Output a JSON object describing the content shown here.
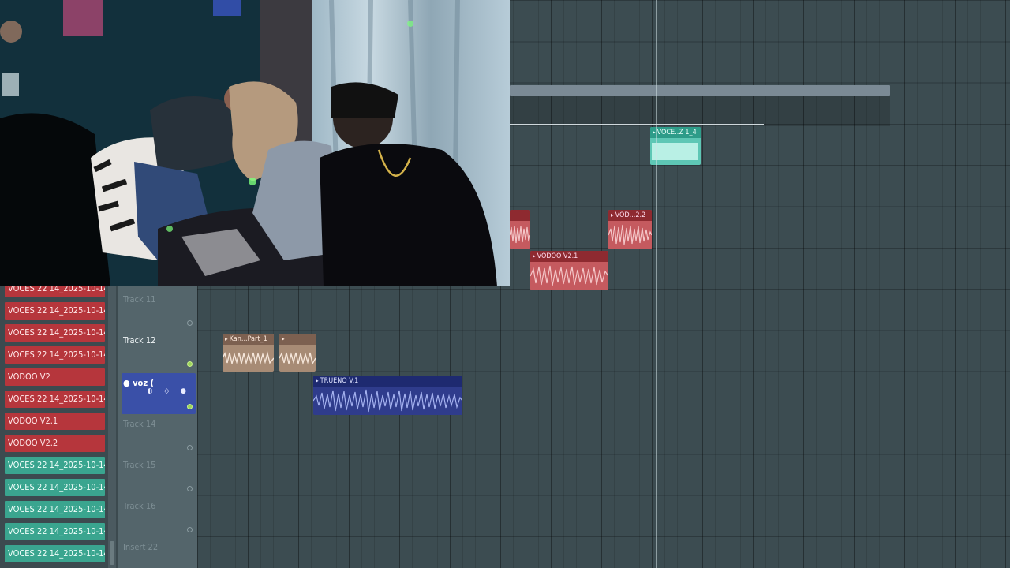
{
  "app": "FL Studio Playlist",
  "tracks": [
    {
      "name": "Track 11",
      "state": "faded"
    },
    {
      "name": "Track 12",
      "state": "normal"
    },
    {
      "name": "voz (",
      "state": "selected"
    },
    {
      "name": "Track 14",
      "state": "faded"
    },
    {
      "name": "Track 15",
      "state": "faded"
    },
    {
      "name": "Track 16",
      "state": "faded"
    },
    {
      "name": "Insert 22",
      "state": "faded"
    }
  ],
  "samples": [
    {
      "label": "VOCES 22 14_2025-10-14...",
      "color": "red"
    },
    {
      "label": "VOCES 22 14_2025-10-14...",
      "color": "red"
    },
    {
      "label": "VOCES 22 14_2025-10-14...",
      "color": "red"
    },
    {
      "label": "VOCES 22 14_2025-10-14...",
      "color": "red"
    },
    {
      "label": "VODOO V2",
      "color": "red"
    },
    {
      "label": "VOCES 22 14_2025-10-14...",
      "color": "red"
    },
    {
      "label": "VODOO V2.1",
      "color": "red"
    },
    {
      "label": "VODOO V2.2",
      "color": "red"
    },
    {
      "label": "VOCES 22 14_2025-10-14...",
      "color": "teal"
    },
    {
      "label": "VOCES 22 14_2025-10-14...",
      "color": "teal"
    },
    {
      "label": "VOCES 22 14_2025-10-14...",
      "color": "teal"
    },
    {
      "label": "VOCES 22 14_2025-10-14...",
      "color": "teal"
    },
    {
      "label": "VOCES 22 14_2025-10-14...",
      "color": "teal"
    }
  ],
  "clips": {
    "voces_z": "VOCE..Z 1_4",
    "vodoo_22": "VOD...2.2",
    "vodoo_v21": "VODOO V2.1",
    "kan_part": "Kan...Part_1",
    "trueno": "TRUENO V.1"
  },
  "icons": {
    "clip_arrow": "▸",
    "track_power": "●",
    "track_controls": "◐ ◇ ●"
  }
}
